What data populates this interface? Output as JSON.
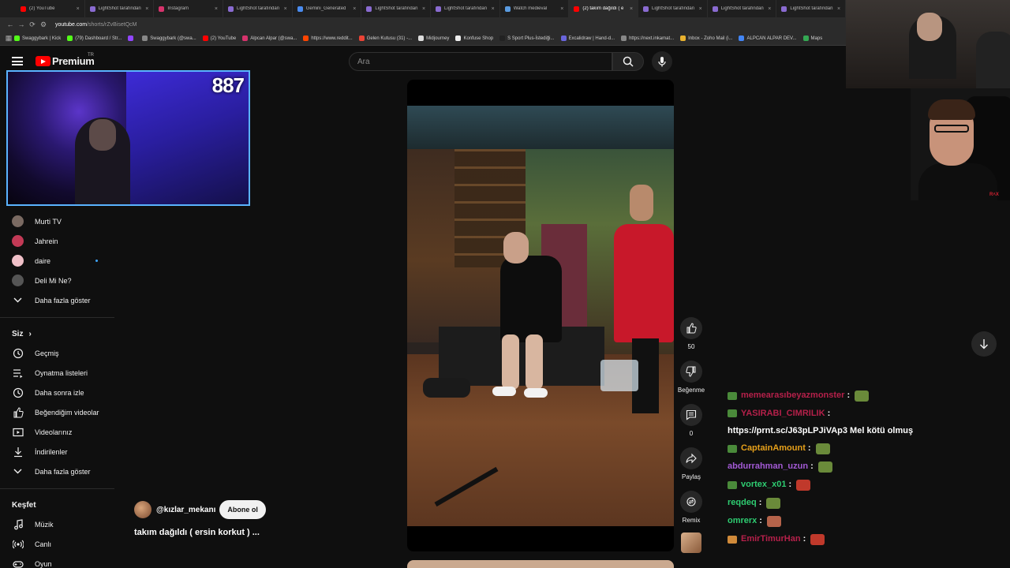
{
  "browser": {
    "tabs": [
      {
        "label": "(2) YouTube",
        "color": "#ff0000",
        "active": false
      },
      {
        "label": "LightShot tarafından",
        "color": "#8a6bd1",
        "active": false
      },
      {
        "label": "Instagram",
        "color": "#d6336c",
        "active": false
      },
      {
        "label": "LightShot tarafından",
        "color": "#8a6bd1",
        "active": false
      },
      {
        "label": "Gemini_Generated",
        "color": "#4a8cf0",
        "active": false
      },
      {
        "label": "LightShot tarafından",
        "color": "#8a6bd1",
        "active": false
      },
      {
        "label": "LightShot tarafından",
        "color": "#8a6bd1",
        "active": false
      },
      {
        "label": "Watch medieval",
        "color": "#5a9be0",
        "active": false
      },
      {
        "label": "(2) takım dağıldı ( e",
        "color": "#ff0000",
        "active": true
      },
      {
        "label": "LightShot tarafından",
        "color": "#8a6bd1",
        "active": false
      },
      {
        "label": "LightShot tarafından",
        "color": "#8a6bd1",
        "active": false
      },
      {
        "label": "LightShot tarafından",
        "color": "#8a6bd1",
        "active": false
      }
    ],
    "url_host": "youtube.com",
    "url_path": "/shorts/rZvBisetQcM",
    "bookmarks": [
      {
        "label": "Swaggybark | Kick",
        "color": "#53fc18"
      },
      {
        "label": "(79) Dashboard / Str...",
        "color": "#53fc18"
      },
      {
        "label": "",
        "color": "#9146ff"
      },
      {
        "label": "Swaggybark (@swa...",
        "color": "#888888"
      },
      {
        "label": "(2) YouTube",
        "color": "#ff0000"
      },
      {
        "label": "Alpcan Alpar (@swa...",
        "color": "#d6336c"
      },
      {
        "label": "https://www.reddit...",
        "color": "#ff4500"
      },
      {
        "label": "Gelen Kutusu (31) -...",
        "color": "#ea4335"
      },
      {
        "label": "Midjourney",
        "color": "#dddddd"
      },
      {
        "label": "Konfuse Shop",
        "color": "#eeeeee"
      },
      {
        "label": "S Sport Plus-İstediği...",
        "color": "#222222"
      },
      {
        "label": "Excalidraw | Hand-d...",
        "color": "#6965db"
      },
      {
        "label": "https://next.inkamat...",
        "color": "#888888"
      },
      {
        "label": "Inbox - Zoho Mail (i...",
        "color": "#e8b12e"
      },
      {
        "label": "ALPCAN ALPAR DEV...",
        "color": "#4285f4"
      },
      {
        "label": "Maps",
        "color": "#34a853"
      }
    ]
  },
  "masthead": {
    "logo_word": "Premium",
    "region": "TR",
    "search_placeholder": "Ara"
  },
  "webcam": {
    "counter": "887"
  },
  "sidebar": {
    "subscriptions": [
      {
        "label": "Murti TV",
        "color": "#7a6a62"
      },
      {
        "label": "Jahrein",
        "color": "#c23a56"
      },
      {
        "label": "daire",
        "color": "#f0c0c8",
        "live_dot": true
      },
      {
        "label": "Deli Mi Ne?",
        "color": "#555555"
      }
    ],
    "show_more": "Daha fazla göster",
    "you_heading": "Siz",
    "you_items": [
      {
        "label": "Geçmiş",
        "icon": "history-icon"
      },
      {
        "label": "Oynatma listeleri",
        "icon": "playlist-icon"
      },
      {
        "label": "Daha sonra izle",
        "icon": "watch-later-icon"
      },
      {
        "label": "Beğendiğim videolar",
        "icon": "like-icon"
      },
      {
        "label": "Videolarınız",
        "icon": "your-videos-icon"
      },
      {
        "label": "İndirilenler",
        "icon": "download-icon"
      }
    ],
    "show_more_2": "Daha fazla göster",
    "explore_heading": "Keşfet",
    "explore_items": [
      {
        "label": "Müzik",
        "icon": "music-icon"
      },
      {
        "label": "Canlı",
        "icon": "live-icon"
      },
      {
        "label": "Oyun",
        "icon": "gaming-icon"
      }
    ]
  },
  "short": {
    "channel": "@kızlar_mekanı",
    "subscribe": "Abone ol",
    "title": "takım dağıldı ( ersin korkut ) ..."
  },
  "actions": {
    "likes": "50",
    "dislike": "Beğenme",
    "comments": "0",
    "share": "Paylaş",
    "remix": "Remix"
  },
  "chat": [
    {
      "user": "memearasıbeyazmonster",
      "color": "#b5204a",
      "text": "",
      "badge": "#4a8a3a",
      "emote": "#6a8a3a"
    },
    {
      "user": "YASIRABI_CIMRILIK",
      "color": "#b5204a",
      "text": "https://prnt.sc/J63pLPJiVAp3 Mel kötü olmuş",
      "badge": "#4a8a3a",
      "emote": ""
    },
    {
      "user": "CaptainAmount",
      "color": "#e6a01a",
      "text": "",
      "badge": "#4a8a3a",
      "emote": "#6a8a3a"
    },
    {
      "user": "abdurrahman_uzun",
      "color": "#a35ad6",
      "text": "",
      "badge": "",
      "emote": "#6a8a3a"
    },
    {
      "user": "vortex_x01",
      "color": "#2ecc71",
      "text": "",
      "badge": "#4a8a3a",
      "emote": "#c0392b"
    },
    {
      "user": "reqdeq",
      "color": "#2ecc71",
      "text": "",
      "badge": "",
      "emote": "#6a8a3a"
    },
    {
      "user": "omrerx",
      "color": "#2ecc71",
      "text": "",
      "badge": "",
      "emote": "#b5634a"
    },
    {
      "user": "EmirTimurHan",
      "color": "#b5204a",
      "text": "",
      "badge": "#d08a3a",
      "emote": "#c0392b"
    }
  ]
}
